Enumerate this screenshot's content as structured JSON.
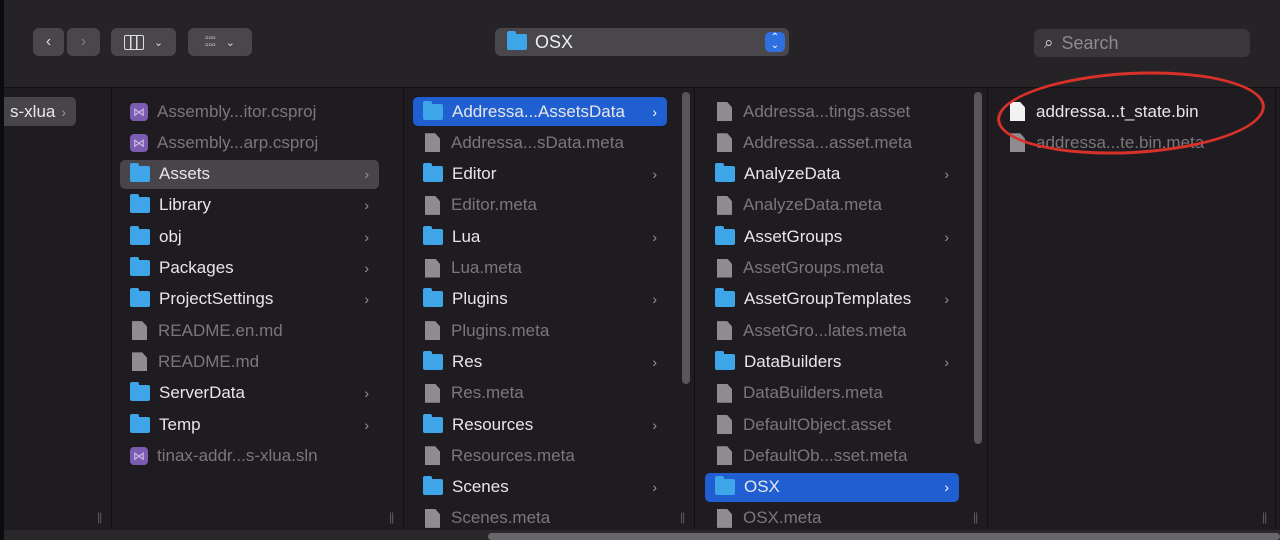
{
  "toolbar": {
    "back_icon": "chevron-left",
    "forward_icon": "chevron-right",
    "view_icon": "columns-view",
    "group_icon": "grid-group",
    "path_title": "OSX",
    "search_placeholder": "Search"
  },
  "columns": [
    {
      "items": [
        {
          "name": "s-xlua",
          "type": "folder-partial",
          "selected": "gray",
          "chevron": true
        }
      ]
    },
    {
      "items": [
        {
          "name": "Assembly...itor.csproj",
          "type": "vs",
          "dim": true
        },
        {
          "name": "Assembly...arp.csproj",
          "type": "vs",
          "dim": true
        },
        {
          "name": "Assets",
          "type": "folder",
          "selected": "gray",
          "chevron": true
        },
        {
          "name": "Library",
          "type": "folder",
          "chevron": true
        },
        {
          "name": "obj",
          "type": "folder",
          "chevron": true
        },
        {
          "name": "Packages",
          "type": "folder",
          "chevron": true
        },
        {
          "name": "ProjectSettings",
          "type": "folder",
          "chevron": true
        },
        {
          "name": "README.en.md",
          "type": "file",
          "dim": true
        },
        {
          "name": "README.md",
          "type": "file",
          "dim": true
        },
        {
          "name": "ServerData",
          "type": "folder",
          "chevron": true
        },
        {
          "name": "Temp",
          "type": "folder",
          "chevron": true
        },
        {
          "name": "tinax-addr...s-xlua.sln",
          "type": "vs",
          "dim": true
        }
      ]
    },
    {
      "items": [
        {
          "name": "Addressa...AssetsData",
          "type": "folder",
          "selected": "blue",
          "chevron": true
        },
        {
          "name": "Addressa...sData.meta",
          "type": "file",
          "dim": true
        },
        {
          "name": "Editor",
          "type": "folder",
          "chevron": true
        },
        {
          "name": "Editor.meta",
          "type": "file",
          "dim": true
        },
        {
          "name": "Lua",
          "type": "folder",
          "chevron": true
        },
        {
          "name": "Lua.meta",
          "type": "file",
          "dim": true
        },
        {
          "name": "Plugins",
          "type": "folder",
          "chevron": true
        },
        {
          "name": "Plugins.meta",
          "type": "file",
          "dim": true
        },
        {
          "name": "Res",
          "type": "folder",
          "chevron": true
        },
        {
          "name": "Res.meta",
          "type": "file",
          "dim": true
        },
        {
          "name": "Resources",
          "type": "folder",
          "chevron": true
        },
        {
          "name": "Resources.meta",
          "type": "file",
          "dim": true
        },
        {
          "name": "Scenes",
          "type": "folder",
          "chevron": true
        },
        {
          "name": "Scenes.meta",
          "type": "file",
          "dim": true
        }
      ]
    },
    {
      "items": [
        {
          "name": "Addressa...tings.asset",
          "type": "file",
          "dim": true
        },
        {
          "name": "Addressa...asset.meta",
          "type": "file",
          "dim": true
        },
        {
          "name": "AnalyzeData",
          "type": "folder",
          "chevron": true
        },
        {
          "name": "AnalyzeData.meta",
          "type": "file",
          "dim": true
        },
        {
          "name": "AssetGroups",
          "type": "folder",
          "chevron": true
        },
        {
          "name": "AssetGroups.meta",
          "type": "file",
          "dim": true
        },
        {
          "name": "AssetGroupTemplates",
          "type": "folder",
          "chevron": true
        },
        {
          "name": "AssetGro...lates.meta",
          "type": "file",
          "dim": true
        },
        {
          "name": "DataBuilders",
          "type": "folder",
          "chevron": true
        },
        {
          "name": "DataBuilders.meta",
          "type": "file",
          "dim": true
        },
        {
          "name": "DefaultObject.asset",
          "type": "file",
          "dim": true
        },
        {
          "name": "DefaultOb...sset.meta",
          "type": "file",
          "dim": true
        },
        {
          "name": "OSX",
          "type": "folder",
          "selected": "blue",
          "chevron": true
        },
        {
          "name": "OSX.meta",
          "type": "file",
          "dim": true
        }
      ]
    },
    {
      "items": [
        {
          "name": "addressa...t_state.bin",
          "type": "file-white"
        },
        {
          "name": "addressa...te.bin.meta",
          "type": "file",
          "dim": true
        }
      ]
    }
  ],
  "annotation": {
    "color": "#d8312a"
  },
  "accent": "#1f5fd1"
}
